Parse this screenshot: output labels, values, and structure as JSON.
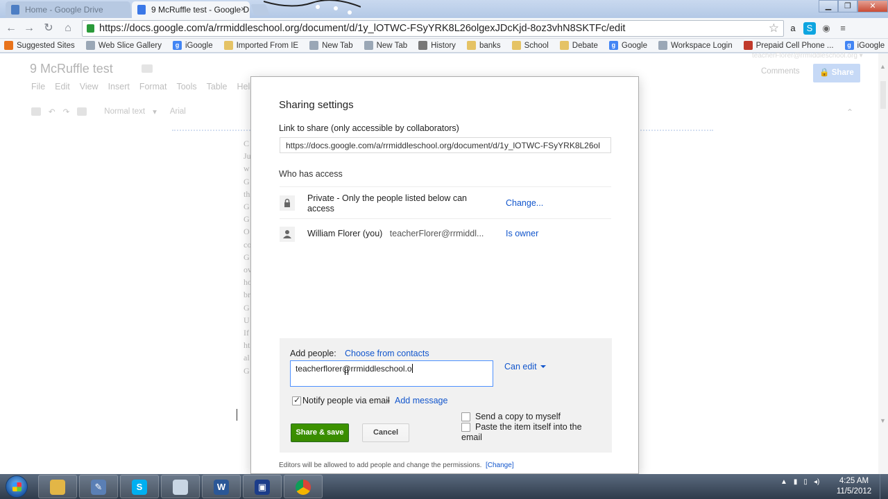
{
  "browser": {
    "tabs": [
      {
        "title": "Home - Google Drive",
        "active": false
      },
      {
        "title": "9 McRuffle test - Google D",
        "active": true
      }
    ],
    "tab_close_glyph": "×",
    "url": "https://docs.google.com/a/rrmiddleschool.org/document/d/1y_lOTWC-FSyYRK8L26olgexJDcKjd-8oz3vhN8SKTFc/edit",
    "bookmarks": [
      {
        "label": "Suggested Sites",
        "icon": "suggested-icon",
        "color": "#e8731c"
      },
      {
        "label": "Web Slice Gallery",
        "icon": "page-icon",
        "color": "#9aa7b6"
      },
      {
        "label": "iGoogle",
        "icon": "google-icon",
        "color": "#4285f4"
      },
      {
        "label": "Imported From IE",
        "icon": "folder-icon",
        "color": "#e5c365"
      },
      {
        "label": "New Tab",
        "icon": "page-icon",
        "color": "#9aa7b6"
      },
      {
        "label": "New Tab",
        "icon": "page-icon",
        "color": "#9aa7b6"
      },
      {
        "label": "History",
        "icon": "history-icon",
        "color": "#777777"
      },
      {
        "label": "banks",
        "icon": "folder-icon",
        "color": "#e5c365"
      },
      {
        "label": "School",
        "icon": "folder-icon",
        "color": "#e5c365"
      },
      {
        "label": "Debate",
        "icon": "folder-icon",
        "color": "#e5c365"
      },
      {
        "label": "Google",
        "icon": "google-icon",
        "color": "#4285f4"
      },
      {
        "label": "Workspace Login",
        "icon": "page-icon",
        "color": "#9aa7b6"
      },
      {
        "label": "Prepaid Cell Phone ...",
        "icon": "prepaid-icon",
        "color": "#c0392b"
      },
      {
        "label": "iGoogle",
        "icon": "google-icon",
        "color": "#4285f4"
      }
    ]
  },
  "doc": {
    "title": "9 McRuffle test",
    "menu": [
      "File",
      "Edit",
      "View",
      "Insert",
      "Format",
      "Tools",
      "Table",
      "Hel"
    ],
    "style_select": "Normal text",
    "font_select": "Arial",
    "comments_label": "Comments",
    "share_label": "Share",
    "body_letters": [
      "C",
      "Ju",
      "w",
      "G",
      "th",
      "G",
      "G",
      "O",
      "co",
      "G",
      "ov",
      "ho",
      "br",
      "G",
      "U",
      "If",
      "ht",
      "al",
      "G"
    ]
  },
  "dialog": {
    "title": "Sharing settings",
    "link_label": "Link to share (only accessible by collaborators)",
    "link_value": "https://docs.google.com/a/rrmiddleschool.org/document/d/1y_lOTWC-FSyYRK8L26ol",
    "who_has_access": "Who has access",
    "access_rows": [
      {
        "icon": "lock-icon",
        "text": "Private - Only the people listed below can access",
        "action": "Change..."
      },
      {
        "icon": "person-icon",
        "name": "William Florer (you)",
        "email": "teacherFlorer@rrmiddl...",
        "action": "Is owner"
      }
    ],
    "add_people_label": "Add people:",
    "choose_contacts": "Choose from contacts",
    "people_input_value": "teacherflorer@rrmiddleschool.o",
    "permission": "Can edit",
    "notify_label": "Notify people via email",
    "notify_sep": " - ",
    "notify_checked": true,
    "add_message": "Add message",
    "send_copy_label": "Send a copy to myself",
    "paste_label": "Paste the item itself into the email",
    "share_button": "Share & save",
    "cancel_button": "Cancel",
    "footer_note": "Editors will be allowed to add people and change the permissions.",
    "footer_change": "[Change]"
  },
  "taskbar": {
    "time": "4:25 AM",
    "date": "11/5/2012"
  },
  "colors": {
    "link_blue": "#1155cc",
    "share_green": "#3d9400",
    "input_focus": "#4d90fe"
  }
}
